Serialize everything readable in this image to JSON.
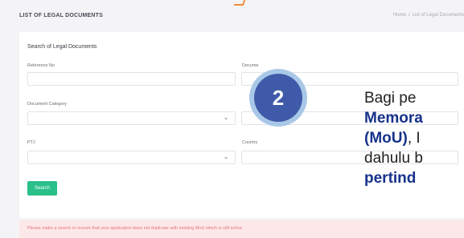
{
  "header": {
    "title": "LIST OF LEGAL DOCUMENTS",
    "breadcrumb": [
      "Home",
      "List of Legal Documents"
    ]
  },
  "search_card": {
    "title": "Search of Legal Documents",
    "fields": {
      "reference_no": {
        "label": "Reference No",
        "value": ""
      },
      "document": {
        "label": "Docume",
        "value": ""
      },
      "document_category": {
        "label": "Document Category",
        "value": ""
      },
      "ptj": {
        "label": "PTJ",
        "value": ""
      },
      "country": {
        "label": "Country",
        "value": ""
      }
    },
    "search_button": "Search"
  },
  "notice": "Please make a search to ensure that your application does not duplicate with existing MoU which is still active.",
  "overlay": {
    "step_number": "2",
    "line1": "Bagi pe",
    "line2": "Memora",
    "line3_bold": "(MoU)",
    "line3_rest": ", I",
    "line4": "dahulu b",
    "line5": "pertind"
  },
  "colors": {
    "accent_green": "#29c08a",
    "step_blue": "#3e5aa8",
    "notice_bg": "#fde8e9",
    "notice_text": "#e4747c"
  }
}
